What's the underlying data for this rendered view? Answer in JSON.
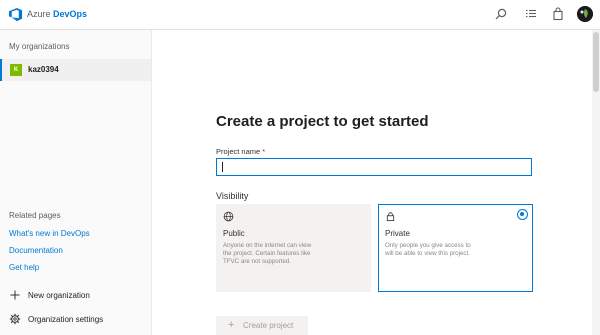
{
  "header": {
    "brand_prefix": "Azure",
    "brand_name": "DevOps",
    "icons": [
      "azure-devops-logo-icon",
      "search-icon",
      "list-icon",
      "shopping-bag-icon"
    ]
  },
  "sidebar": {
    "heading": "My organizations",
    "organization": {
      "badge": "K",
      "name": "kaz0394"
    },
    "related_heading": "Related pages",
    "links": [
      "What's new in DevOps",
      "Documentation",
      "Get help"
    ],
    "actions": [
      {
        "icon": "plus-icon",
        "label": "New organization"
      },
      {
        "icon": "gear-icon",
        "label": "Organization settings"
      }
    ]
  },
  "main": {
    "title": "Create a project to get started",
    "project_name_label": "Project name",
    "required_marker": "*",
    "project_name_value": "",
    "visibility_label": "Visibility",
    "options": [
      {
        "icon": "globe-icon",
        "name": "Public",
        "description": "Anyone on the internet can view the project. Certain features like TFVC are not supported.",
        "selected": false
      },
      {
        "icon": "lock-icon",
        "name": "Private",
        "description": "Only people you give access to will be able to view this project.",
        "selected": true
      }
    ],
    "create_button": {
      "icon": "plus-icon",
      "label": "Create project"
    }
  },
  "colors": {
    "accent": "#0078d4",
    "org_badge": "#7fba00",
    "required": "#a4262c"
  }
}
